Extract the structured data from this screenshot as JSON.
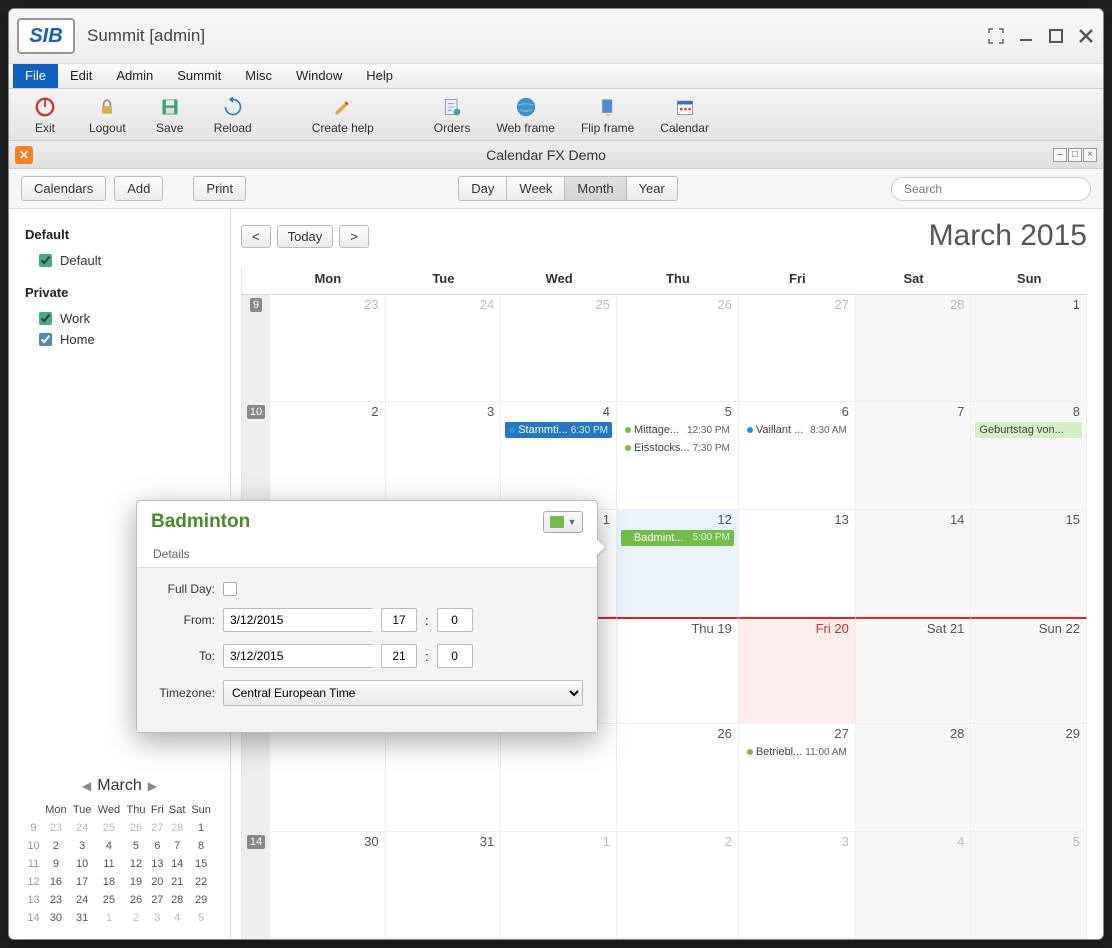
{
  "window": {
    "title": "Summit [admin]"
  },
  "menubar": [
    "File",
    "Edit",
    "Admin",
    "Summit",
    "Misc",
    "Window",
    "Help"
  ],
  "toolbar": [
    {
      "label": "Exit",
      "icon": "power"
    },
    {
      "label": "Logout",
      "icon": "lock"
    },
    {
      "label": "Save",
      "icon": "save"
    },
    {
      "label": "Reload",
      "icon": "reload"
    },
    {
      "label": "Create help",
      "icon": "pencil"
    },
    {
      "label": "Orders",
      "icon": "orders"
    },
    {
      "label": "Web frame",
      "icon": "globe"
    },
    {
      "label": "Flip frame",
      "icon": "flip"
    },
    {
      "label": "Calendar",
      "icon": "calendar"
    }
  ],
  "subwindow": {
    "title": "Calendar FX Demo"
  },
  "controls": {
    "calendars": "Calendars",
    "add": "Add",
    "print": "Print",
    "views": [
      "Day",
      "Week",
      "Month",
      "Year"
    ],
    "active_view": "Month",
    "search_placeholder": "Search",
    "prev": "<",
    "today": "Today",
    "next": ">",
    "month_title": "March 2015"
  },
  "sidebar": {
    "groups": [
      {
        "label": "Default",
        "items": [
          {
            "label": "Default",
            "checked": true,
            "color": "#4b9"
          }
        ]
      },
      {
        "label": "Private",
        "items": [
          {
            "label": "Work",
            "checked": true,
            "color": "#4b9"
          },
          {
            "label": "Home",
            "checked": true,
            "color": "#58a"
          }
        ]
      }
    ]
  },
  "minical": {
    "label": "March",
    "dow": [
      "Mon",
      "Tue",
      "Wed",
      "Thu",
      "Fri",
      "Sat",
      "Sun"
    ],
    "rows": [
      {
        "wk": "9",
        "d": [
          "23",
          "24",
          "25",
          "26",
          "27",
          "28",
          "1"
        ],
        "other": [
          0,
          1,
          2,
          3,
          4,
          5
        ]
      },
      {
        "wk": "10",
        "d": [
          "2",
          "3",
          "4",
          "5",
          "6",
          "7",
          "8"
        ]
      },
      {
        "wk": "11",
        "d": [
          "9",
          "10",
          "11",
          "12",
          "13",
          "14",
          "15"
        ]
      },
      {
        "wk": "12",
        "d": [
          "16",
          "17",
          "18",
          "19",
          "20",
          "21",
          "22"
        ]
      },
      {
        "wk": "13",
        "d": [
          "23",
          "24",
          "25",
          "26",
          "27",
          "28",
          "29"
        ]
      },
      {
        "wk": "14",
        "d": [
          "30",
          "31",
          "1",
          "2",
          "3",
          "4",
          "5"
        ],
        "other": [
          2,
          3,
          4,
          5,
          6
        ]
      }
    ]
  },
  "calendar": {
    "dow": [
      "Mon",
      "Tue",
      "Wed",
      "Thu",
      "Fri",
      "Sat",
      "Sun"
    ],
    "weeks": [
      "9",
      "10",
      "",
      "",
      "",
      "14"
    ],
    "row4_labels": [
      "",
      "",
      "",
      "Thu 19",
      "Fri 20",
      "Sat 21",
      "Sun 22"
    ],
    "cells": [
      [
        "23",
        "24",
        "25",
        "26",
        "27",
        "28",
        "1"
      ],
      [
        "2",
        "3",
        "4",
        "5",
        "6",
        "7",
        "8"
      ],
      [
        "",
        "",
        "1",
        "12",
        "13",
        "14",
        "15"
      ],
      [
        "",
        "",
        "",
        "19",
        "20",
        "21",
        "22"
      ],
      [
        "",
        "",
        "",
        "26",
        "27",
        "28",
        "29"
      ],
      [
        "30",
        "31",
        "1",
        "2",
        "3",
        "4",
        "5"
      ]
    ],
    "events": {
      "r1c2": [
        {
          "cls": "blue",
          "dot": "b",
          "text": "Stammti...",
          "time": "6:30 PM"
        }
      ],
      "r1c3": [
        {
          "cls": "dot",
          "dot": "g",
          "text": "Mittage...",
          "time": "12:30 PM"
        },
        {
          "cls": "dot",
          "dot": "g",
          "text": "Eisstocks...",
          "time": "7:30 PM"
        }
      ],
      "r1c4": [
        {
          "cls": "dot",
          "dot": "b",
          "text": "Vaillant ...",
          "time": "8:30 AM"
        }
      ],
      "r1c6": [
        {
          "cls": "lightgreen",
          "text": "Geburtstag von..."
        }
      ],
      "r2c3": [
        {
          "cls": "green",
          "dot": "g",
          "text": "Badmint...",
          "time": "5:00 PM"
        }
      ],
      "r4c4": [
        {
          "cls": "dot",
          "dot": "g",
          "text": "Betriebl...",
          "time": "11:00 AM"
        }
      ]
    }
  },
  "popup": {
    "title": "Badminton",
    "tab": "Details",
    "fullday_label": "Full Day:",
    "from_label": "From:",
    "to_label": "To:",
    "tz_label": "Timezone:",
    "from_date": "3/12/2015",
    "from_h": "17",
    "from_m": "0",
    "to_date": "3/12/2015",
    "to_h": "21",
    "to_m": "0",
    "colon": ":",
    "timezone": "Central European Time"
  }
}
